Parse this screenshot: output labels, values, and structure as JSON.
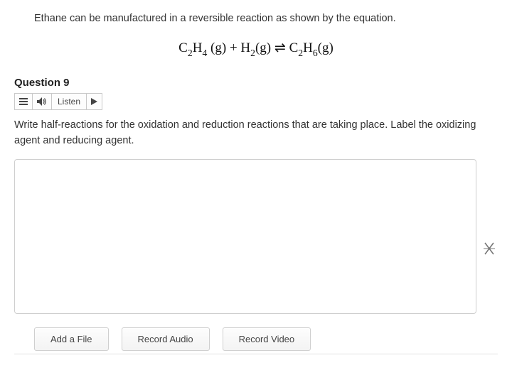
{
  "intro": "Ethane can be manufactured in a reversible reaction as shown by the equation.",
  "equation": {
    "reactant1_base": "C",
    "reactant1_sub1": "2",
    "reactant1_base2": "H",
    "reactant1_sub2": "4",
    "reactant1_state": " (g)",
    "plus": " + ",
    "reactant2_base": "H",
    "reactant2_sub": "2",
    "reactant2_state": "(g)",
    "arrow": " ⇌ ",
    "product_base": "C",
    "product_sub1": "2",
    "product_base2": "H",
    "product_sub2": "6",
    "product_state": "(g)"
  },
  "question": {
    "heading": "Question 9",
    "listen_label": "Listen",
    "prompt": "Write half-reactions for the oxidation and reduction reactions that are taking place. Label the oxidizing agent and reducing agent.",
    "textarea_placeholder": ""
  },
  "actions": {
    "add_file": "Add a File",
    "record_audio": "Record Audio",
    "record_video": "Record Video"
  }
}
